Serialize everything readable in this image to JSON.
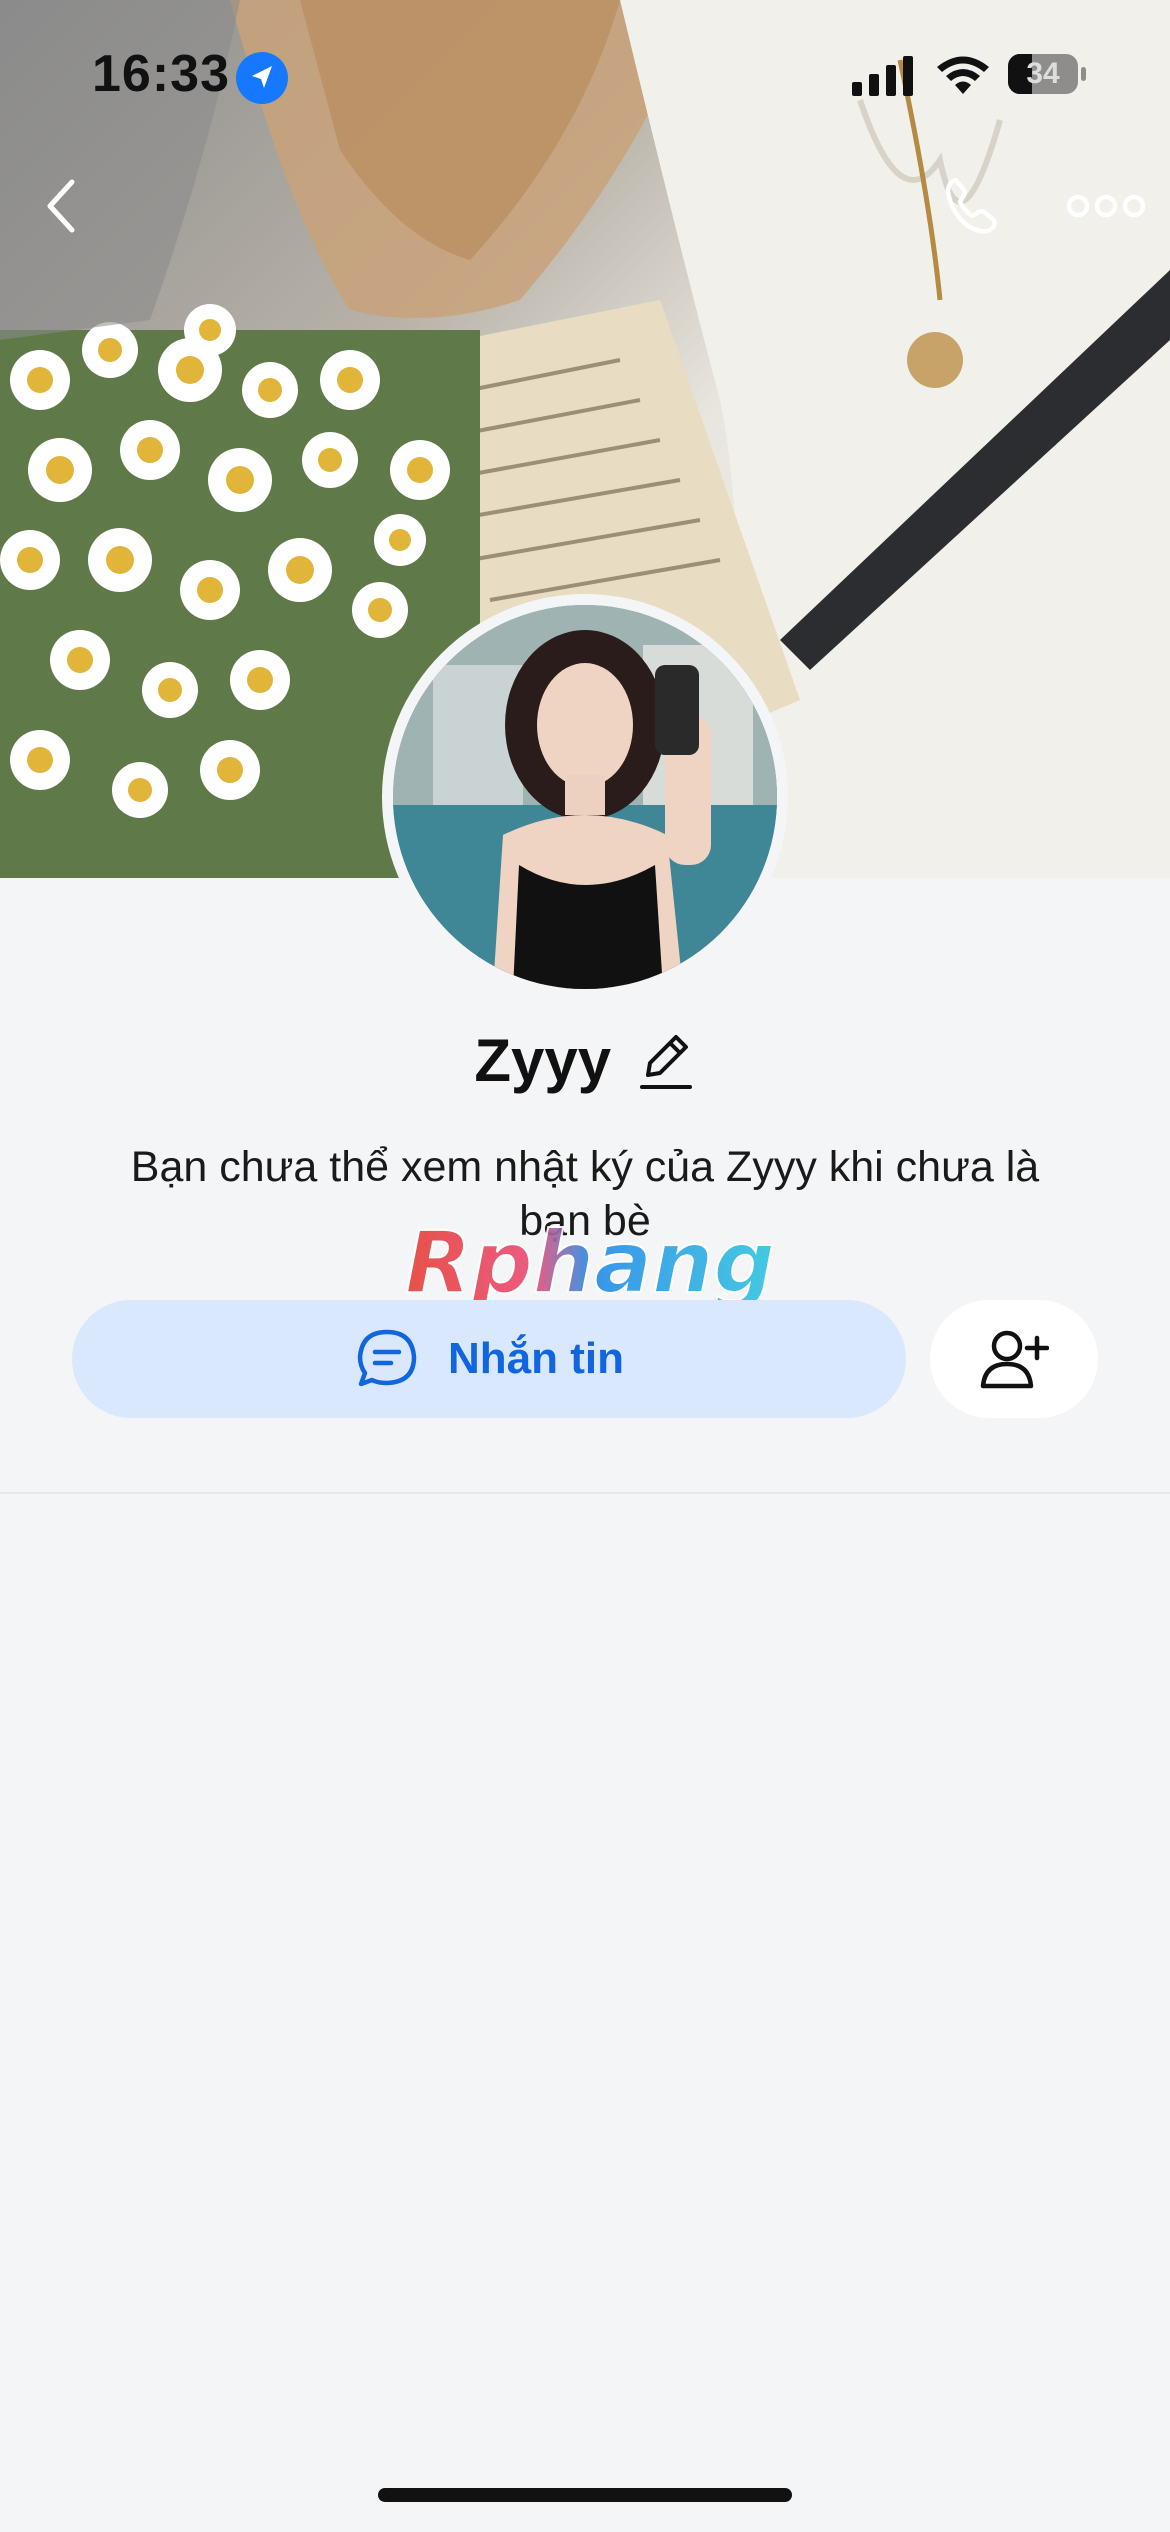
{
  "status_bar": {
    "time": "16:33",
    "battery_level": "34",
    "location_icon": "location-arrow-icon",
    "signal_icon": "cellular-signal-icon",
    "wifi_icon": "wifi-icon"
  },
  "nav": {
    "back_icon": "chevron-left-icon",
    "call_icon": "phone-icon",
    "more_icon": "more-horizontal-icon"
  },
  "profile": {
    "name": "Zyyy",
    "edit_icon": "pencil-icon",
    "notice": "Bạn chưa thể xem nhật ký của Zyyy khi chưa là bạn bè"
  },
  "watermark": {
    "text": "Rphang"
  },
  "actions": {
    "message_label": "Nhắn tin",
    "message_icon": "chat-bubble-icon",
    "add_friend_icon": "add-user-icon"
  },
  "colors": {
    "accent": "#1166e0",
    "button_bg": "#d9e8fd",
    "page_bg": "#f4f5f7"
  }
}
